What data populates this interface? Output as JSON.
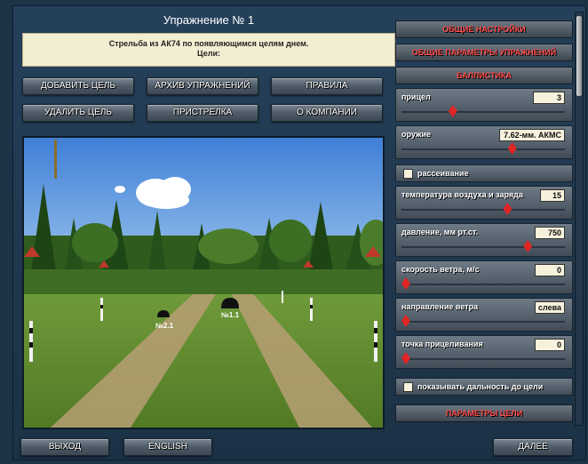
{
  "header": {
    "title": "Упражнение № 1",
    "task_line1": "Стрельба из  АК74 по появляющимся целям днем.",
    "task_line2": "Цели:"
  },
  "toolbar": {
    "add_target": "ДОБАВИТЬ ЦЕЛЬ",
    "archive": "АРХИВ УПРАЖНЕНИЙ",
    "rules": "ПРАВИЛА",
    "delete_target": "УДАЛИТЬ  ЦЕЛЬ",
    "zeroing": "ПРИСТРЕЛКА",
    "about": "О КОМПАНИИ"
  },
  "scene": {
    "target1_label": "№2.1",
    "target2_label": "№1.1"
  },
  "panel": {
    "general_settings": "ОБЩИЕ НАСТРОЙКИ",
    "general_params": "ОБЩИЕ ПАРАМЕТРЫ УПРАЖНЕНИЙ",
    "ballistics": "БАЛЛИСТИКА",
    "target_params": "ПАРАМЕТРЫ ЦЕЛИ",
    "params": [
      {
        "label": "прицел",
        "value": "3",
        "level": 0.3
      },
      {
        "label": "оружие",
        "value": "7.62-мм. АКМС",
        "level": 0.68
      },
      {
        "label": "температура воздуха и заряда",
        "value": "15",
        "level": 0.65
      },
      {
        "label": "давление, мм рт.ст.",
        "value": "750",
        "level": 0.78
      },
      {
        "label": "скорость ветра, м/с",
        "value": "0",
        "level": 0.0
      },
      {
        "label": "направление ветра",
        "value": "слева",
        "level": 0.0
      },
      {
        "label": "точка прицеливания",
        "value": "0",
        "level": 0.0
      }
    ],
    "scatter_label": "рассеивание",
    "show_distance_label": "показывать дальность до цели"
  },
  "footer": {
    "exit": "ВЫХОД",
    "english": "ENGLISH",
    "next": "ДАЛЕЕ"
  },
  "colors": {
    "accent_red": "#ff4f4f",
    "slider_red": "#e02525",
    "panel_bg": "#1d3346"
  }
}
